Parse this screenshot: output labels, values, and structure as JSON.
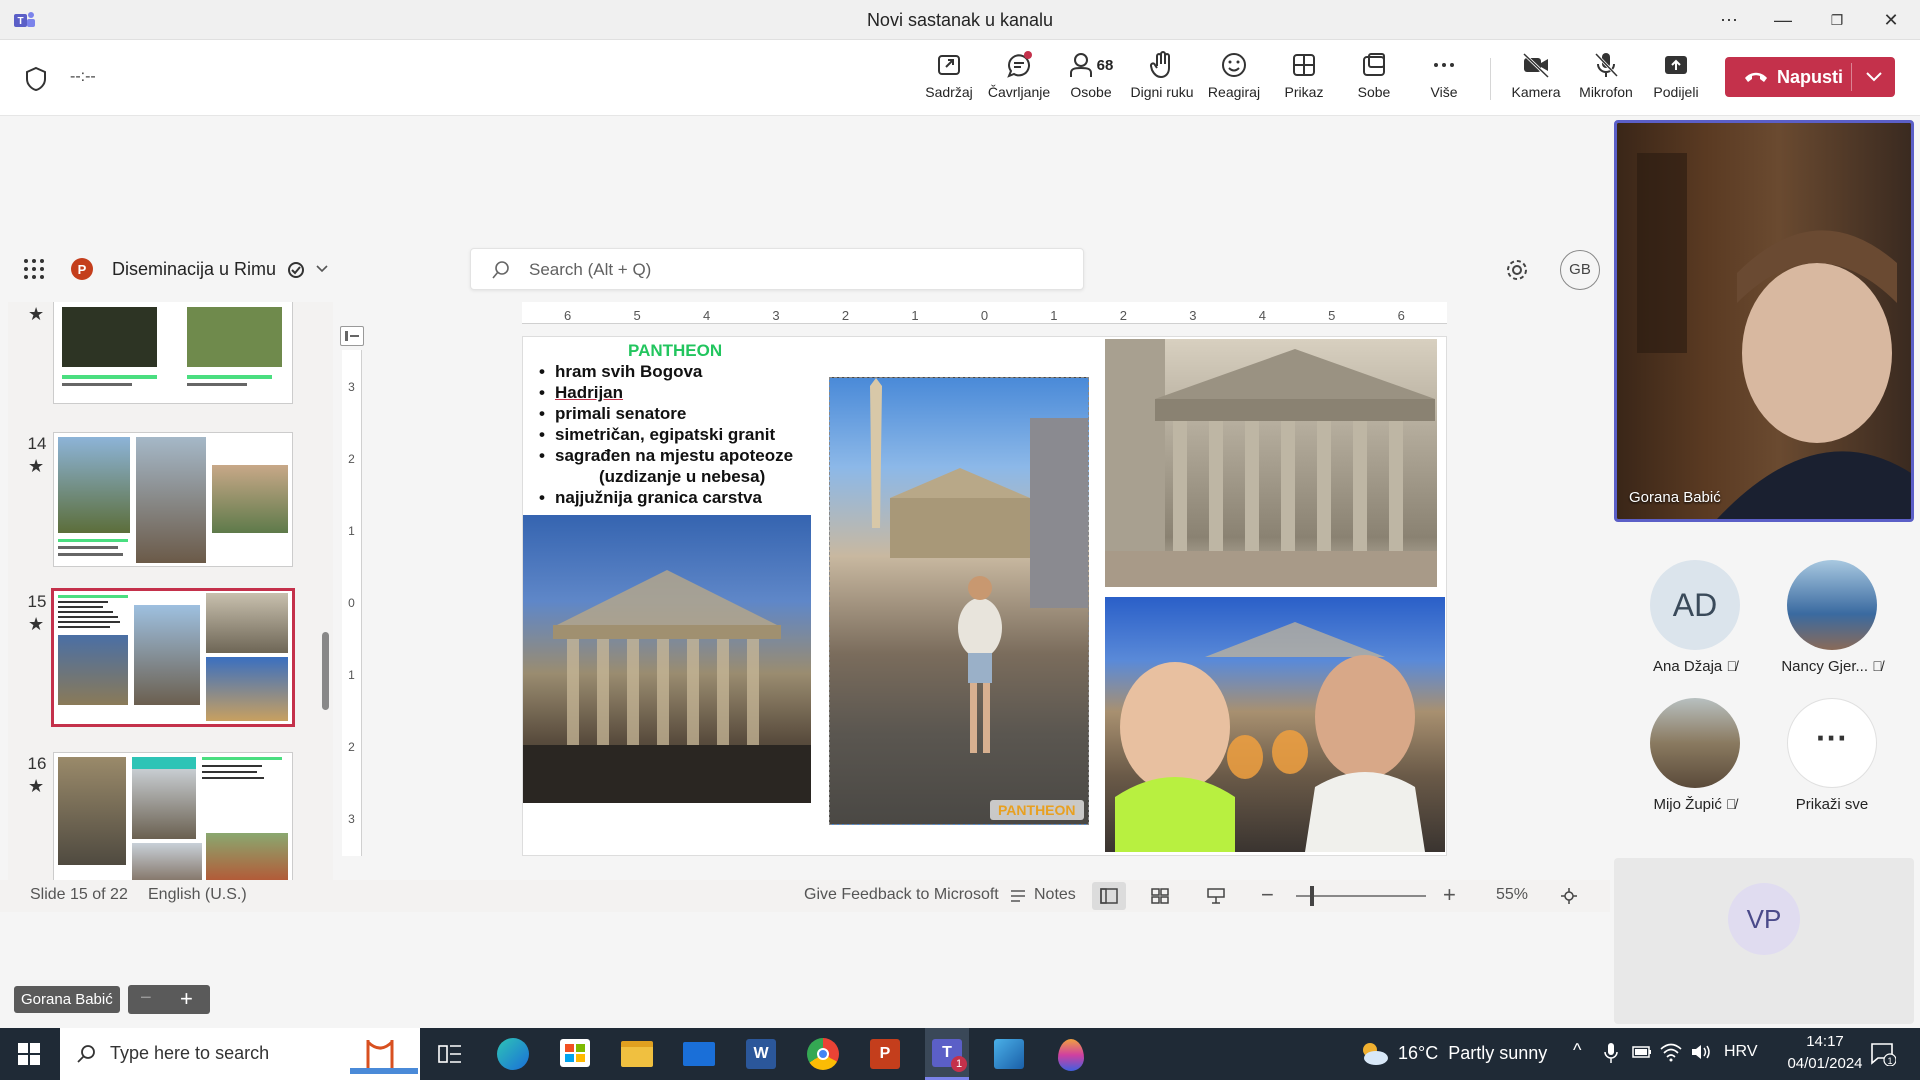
{
  "window": {
    "title": "Novi sastanak u kanalu"
  },
  "meeting": {
    "timer": "--:--"
  },
  "toolbar": {
    "buttons": [
      {
        "label": "Sadržaj",
        "icon": "share-content-icon"
      },
      {
        "label": "Čavrljanje",
        "icon": "chat-icon"
      },
      {
        "label": "Osobe",
        "icon": "people-icon",
        "count": "68"
      },
      {
        "label": "Digni ruku",
        "icon": "raise-hand-icon"
      },
      {
        "label": "Reagiraj",
        "icon": "react-icon"
      },
      {
        "label": "Prikaz",
        "icon": "view-icon"
      },
      {
        "label": "Sobe",
        "icon": "rooms-icon"
      },
      {
        "label": "Više",
        "icon": "more-icon"
      },
      {
        "label": "Kamera",
        "icon": "camera-off-icon"
      },
      {
        "label": "Mikrofon",
        "icon": "mic-off-icon"
      },
      {
        "label": "Podijeli",
        "icon": "share-icon"
      }
    ],
    "leave_label": "Napusti"
  },
  "ppt": {
    "filename": "Diseminacija u Rimu",
    "search_placeholder": "Search (Alt + Q)",
    "user_initials": "GB",
    "status": {
      "slide": "Slide 15 of 22",
      "language": "English (U.S.)",
      "feedback": "Give Feedback to Microsoft",
      "notes": "Notes",
      "zoom": "55%"
    },
    "thumbnails": [
      {
        "num": ""
      },
      {
        "num": "14"
      },
      {
        "num": "15"
      },
      {
        "num": "16"
      }
    ],
    "ruler_top": [
      "6",
      "5",
      "4",
      "3",
      "2",
      "1",
      "0",
      "1",
      "2",
      "3",
      "4",
      "5",
      "6"
    ],
    "ruler_left": [
      "3",
      "2",
      "1",
      "0",
      "1",
      "2",
      "3"
    ]
  },
  "slide": {
    "title": "PANTHEON",
    "bullets": [
      "hram svih Bogova",
      "Hadrijan",
      "primali senatore",
      "simetričan, egipatski granit",
      "sagrađen na mjestu apoteoze",
      "najjužnija granica carstva"
    ],
    "bullet_continuation": "(uzdizanje u nebesa)",
    "photo_tag": "PANTHEON"
  },
  "video": {
    "speaker": "Gorana Babić"
  },
  "participants": [
    {
      "name": "Ana Džaja",
      "initials": "AD"
    },
    {
      "name": "Nancy Gjer...",
      "initials": ""
    },
    {
      "name": "Mijo Župić",
      "initials": ""
    },
    {
      "name": "Prikaži sve",
      "initials": ""
    }
  ],
  "extra_participant": {
    "initials": "VP"
  },
  "presenter_label": "Gorana Babić",
  "taskbar": {
    "search_placeholder": "Type here to search",
    "weather": "16°C  Partly sunny",
    "language": "HRV",
    "time": "14:17",
    "date": "04/01/2024",
    "notification_count": "1"
  },
  "colors": {
    "accent": "#5b5fc7",
    "leave": "#c4314b",
    "slide_title": "#22c55e"
  }
}
